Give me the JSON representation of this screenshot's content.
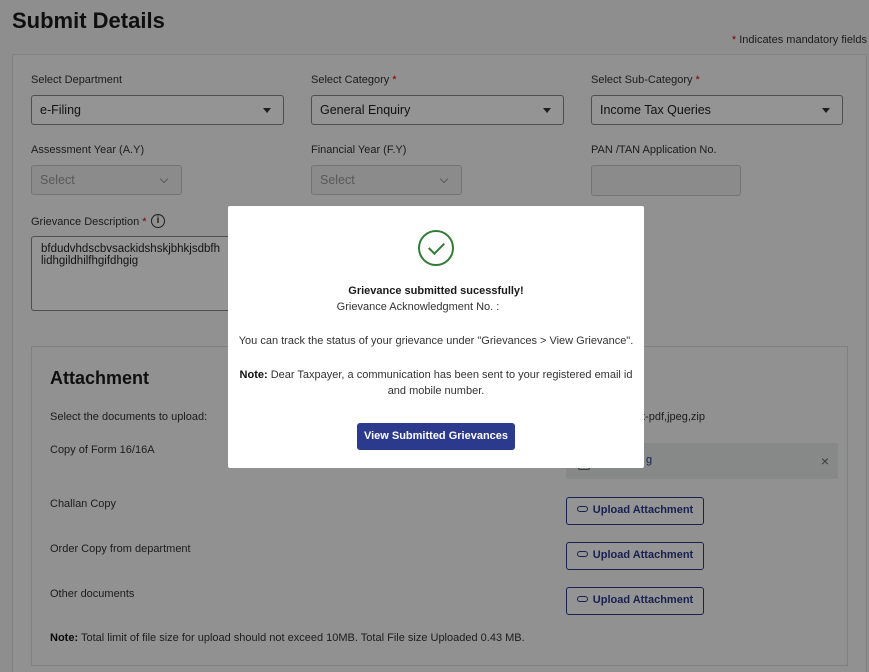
{
  "page": {
    "title": "Submit Details",
    "mandatory_star": "*",
    "mandatory_note": "Indicates mandatory fields"
  },
  "form": {
    "department": {
      "label": "Select Department",
      "value": "e-Filing"
    },
    "category": {
      "label": "Select Category",
      "value": "General Enquiry",
      "star": "*"
    },
    "subcategory": {
      "label": "Select Sub-Category",
      "value": "Income Tax Queries",
      "star": "*"
    },
    "assessment_year": {
      "label": "Assessment Year (A.Y)",
      "placeholder": "Select"
    },
    "financial_year": {
      "label": "Financial Year (F.Y)",
      "placeholder": "Select"
    },
    "pan_tan": {
      "label": "PAN /TAN Application No.",
      "value": ""
    },
    "grievance": {
      "label": "Grievance Description",
      "star": "*",
      "info_icon": "info-icon",
      "value_line1": "bfdudvhdscbvsackidshskjbhkjsdbfh",
      "value_line2": "lidhgildhilfhgifdhgig"
    }
  },
  "attachment": {
    "title": "Attachment",
    "select_docs": "Select the documents to upload:",
    "file_types_fragment": "t-pdf,jpeg,zip",
    "rows": [
      {
        "label": "Copy of Form 16/16A"
      },
      {
        "label": "Challan Copy",
        "button": "Upload Attachment"
      },
      {
        "label": "Order Copy from department",
        "button": "Upload Attachment"
      },
      {
        "label": "Other documents",
        "button": "Upload Attachment"
      }
    ],
    "file_chip": {
      "name_fragment": "g",
      "close": "×"
    },
    "note_label": "Note:",
    "note_text": " Total limit of file size for upload should not exceed 10MB. Total File size Uploaded 0.43 MB."
  },
  "modal": {
    "icon": "check-circle-icon",
    "title": "Grievance submitted sucessfully!",
    "ack": "Grievance Acknowledgment No. :",
    "track": "You can track the status of your grievance under \"Grievances > View Grievance\".",
    "note_label": "Note:",
    "note_line1": " Dear Taxpayer, a communication has been sent to your registered email id",
    "note_line2": "and mobile number.",
    "button": "View Submitted Grievances"
  },
  "colors": {
    "primary": "#2b3a8c",
    "success": "#2e7d32",
    "required": "#dd0000"
  }
}
